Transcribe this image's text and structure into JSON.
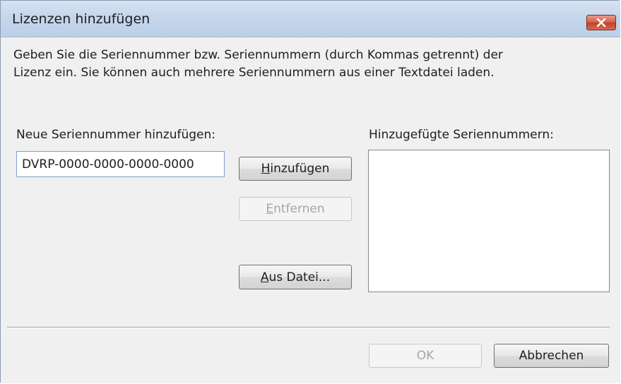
{
  "window": {
    "title": "Lizenzen hinzufügen",
    "close_icon": "close-icon"
  },
  "description": {
    "line1": "Geben Sie die Seriennummer bzw. Seriennummern (durch Kommas getrennt) der",
    "line2": "Lizenz ein. Sie können auch mehrere Seriennummern aus einer Textdatei laden."
  },
  "form": {
    "new_serial_label": "Neue Seriennummer hinzufügen:",
    "serial_value": "DVRP-0000-0000-0000-0000",
    "added_serials_label": "Hinzugefügte Seriennummern:",
    "added_serials": []
  },
  "buttons": {
    "add": {
      "mnemonic": "H",
      "rest": "inzufügen",
      "enabled": true
    },
    "remove": {
      "mnemonic": "E",
      "rest": "ntfernen",
      "enabled": false
    },
    "from_file": {
      "mnemonic": "A",
      "rest": "us Datei...",
      "enabled": true
    },
    "ok": {
      "label": "OK",
      "enabled": false
    },
    "cancel": {
      "label": "Abbrechen",
      "enabled": true
    }
  },
  "colors": {
    "close_button": "#c9442e",
    "titlebar": "#c6d6eb",
    "dialog_background": "#f0f0f0",
    "disabled_text": "#a6a6a6"
  }
}
